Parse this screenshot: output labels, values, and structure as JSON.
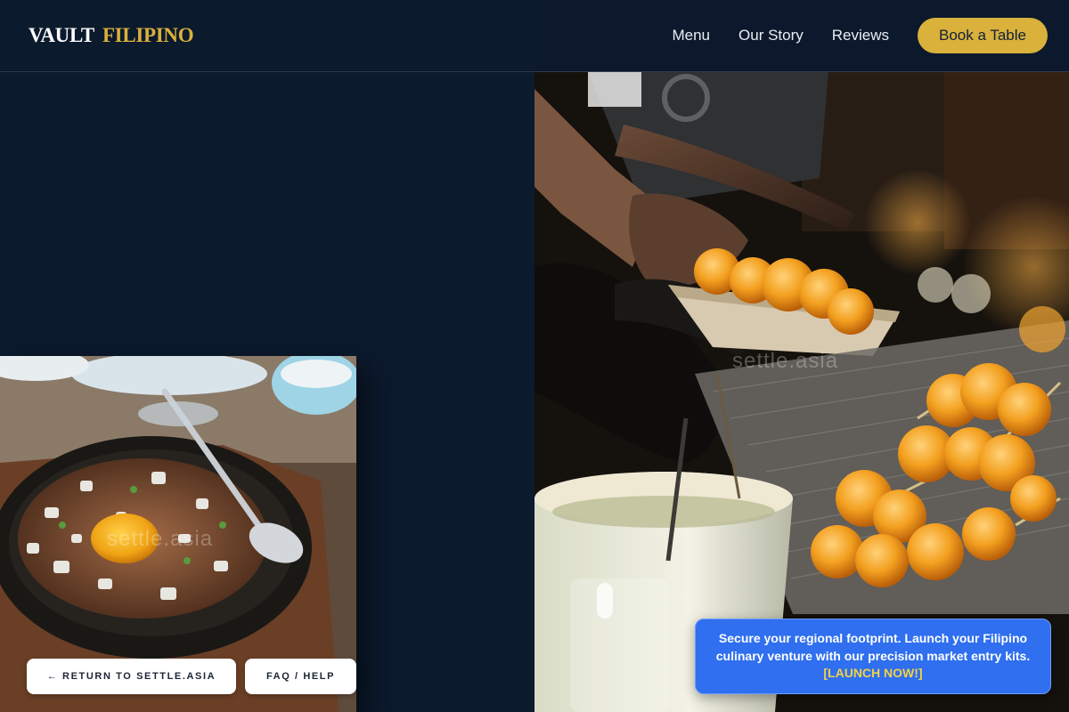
{
  "brand": {
    "name_primary": "VAULT",
    "name_accent": "FILIPINO"
  },
  "nav": {
    "links": [
      "Menu",
      "Our Story",
      "Reviews"
    ],
    "cta_label": "Book a Table"
  },
  "images": {
    "hero_alt": "street-food-vendor-photo",
    "inset_alt": "sizzling-sisig-plate-photo",
    "watermark": "settle.asia"
  },
  "footer_buttons": {
    "return_label": "← RETURN TO SETTLE.ASIA",
    "faq_label": "FAQ / HELP"
  },
  "promo": {
    "text": "Secure your regional footprint. Launch your Filipino culinary venture with our precision market entry kits.",
    "link_label": "[LAUNCH NOW!]"
  },
  "colors": {
    "background": "#0c1a2e",
    "accent_gold": "#d9b13b",
    "promo_blue": "#2f6ff0",
    "promo_link": "#f2d245"
  }
}
